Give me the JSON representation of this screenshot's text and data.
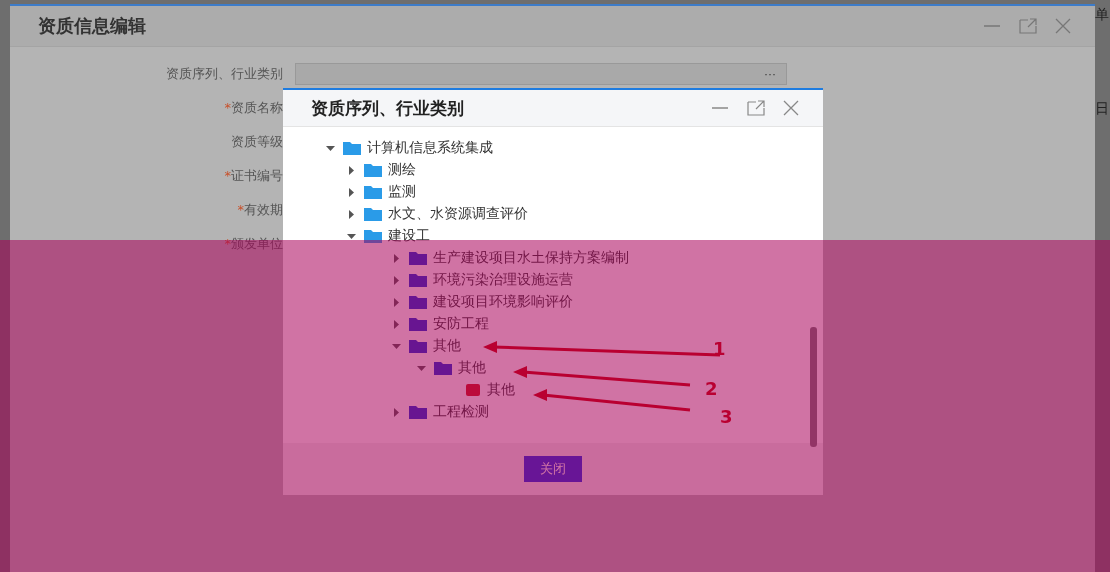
{
  "main_dialog": {
    "title": "资质信息编辑",
    "form": [
      {
        "label": "资质序列、行业类别",
        "field_button": "···"
      },
      {
        "label": "资质名称",
        "required_mark": "*"
      },
      {
        "label": "资质等级"
      },
      {
        "label": "证书编号",
        "required_mark": "*"
      },
      {
        "label": "有效期",
        "required_mark": "*"
      },
      {
        "label": "颁发单位",
        "required_mark": "*"
      }
    ]
  },
  "edge_texts": [
    "单",
    "日"
  ],
  "tree_dialog": {
    "title": "资质序列、行业类别",
    "close_button": "关闭",
    "tree": [
      {
        "label": "计算机信息系统集成",
        "kind": "folder",
        "expanded": true,
        "children": [
          {
            "label": "测绘",
            "kind": "folder",
            "expanded": false
          },
          {
            "label": "监测",
            "kind": "folder",
            "expanded": false
          },
          {
            "label": "水文、水资源调查评价",
            "kind": "folder",
            "expanded": false
          },
          {
            "label": "建设工",
            "kind": "folder",
            "expanded": true,
            "children": [
              {
                "label": "生产建设项目水土保持方案编制",
                "kind": "folder",
                "expanded": false
              },
              {
                "label": "环境污染治理设施运营",
                "kind": "folder",
                "expanded": false
              },
              {
                "label": "建设项目环境影响评价",
                "kind": "folder",
                "expanded": false
              },
              {
                "label": "安防工程",
                "kind": "folder",
                "expanded": false
              },
              {
                "label": "其他",
                "kind": "folder",
                "expanded": true,
                "children": [
                  {
                    "label": "其他",
                    "kind": "folder",
                    "expanded": true,
                    "children": [
                      {
                        "label": "其他",
                        "kind": "leaf"
                      }
                    ]
                  }
                ]
              },
              {
                "label": "工程检测",
                "kind": "folder",
                "expanded": false
              }
            ]
          }
        ]
      }
    ],
    "annotations": [
      {
        "label": "1"
      },
      {
        "label": "2"
      },
      {
        "label": "3"
      }
    ]
  }
}
